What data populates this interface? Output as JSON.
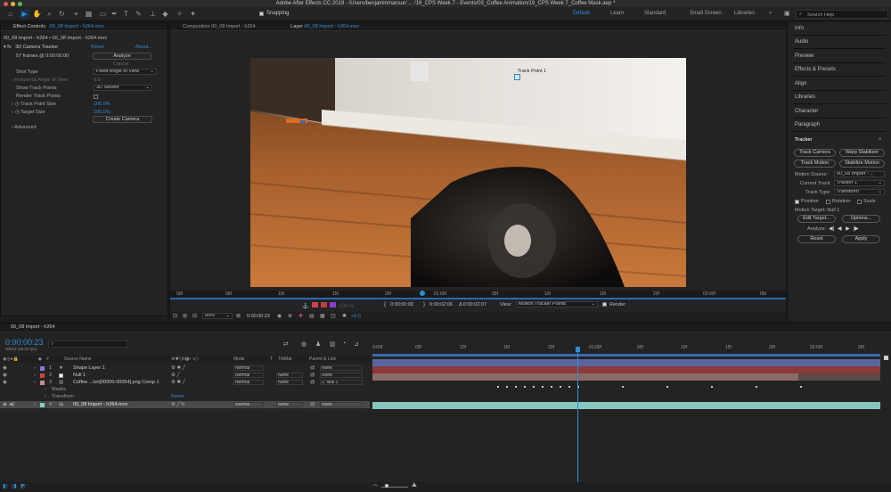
{
  "window": {
    "title": "Adobe After Effects CC 2019 - /Users/benjaminmansur/ ... /19_CPS Week 7 - Events/03_Coffee Animation/19_CPS Week 7_Coffee Mask.aep *"
  },
  "toolbar": {
    "snapping_label": "Snapping",
    "workspaces": [
      "Default",
      "Learn",
      "Standard",
      "Small Screen",
      "Libraries"
    ],
    "active_workspace": "Default",
    "search_placeholder": "Search Help"
  },
  "effect_controls": {
    "tab_label": "Effect Controls",
    "tab_layer": "00_08 Import - h264.mov",
    "breadcrumb": "00_08 Import - h264 • 00_08 Import - h264.mov",
    "effect_name": "3D Camera Tracker",
    "reset_label": "Reset",
    "about_label": "About...",
    "analyze_label": "Analyze",
    "frames_text": "57 frames @ 0:00:00:00",
    "cancel_label": "Cancel",
    "props": {
      "shot_type_label": "Shot Type",
      "shot_type_value": "Fixed Angle of View",
      "hfov_label": "Horizontal Angle of View",
      "hfov_value": "0.0",
      "show_points_label": "Show Track Points",
      "show_points_value": "3D Solved",
      "render_points_label": "Render Track Points",
      "point_size_label": "Track Point Size",
      "point_size_value": "100.0%",
      "target_size_label": "Target Size",
      "target_size_value": "100.0%",
      "create_camera_label": "Create Camera",
      "advanced_label": "Advanced"
    }
  },
  "viewer": {
    "comp_tab": "Composition 00_08 Import - h264",
    "layer_tab_prefix": "Layer",
    "layer_tab_name": "00_08 Import - h264.mov",
    "track_point_label": "Track Point 1",
    "ruler_ticks": [
      "00f",
      "05f",
      "10f",
      "15f",
      "20f",
      "01:00f",
      "05f",
      "10f",
      "15f",
      "20f",
      "02:00f",
      "05f"
    ],
    "in_time": "0:00:00:00",
    "out_time": "0:00:02:06",
    "duration": "Δ 0:00:02:07",
    "view_label": "View:",
    "view_value": "Motion Tracker Points",
    "render_label": "Render",
    "percent_label": "100 %",
    "zoom": "50%",
    "timecode": "0:00:00:23",
    "exposure": "+0.0"
  },
  "right_panel": {
    "items": [
      "Info",
      "Audio",
      "Preview",
      "Effects & Presets",
      "Align",
      "Libraries",
      "Character",
      "Paragraph"
    ],
    "tracker": {
      "title": "Tracker",
      "track_camera": "Track Camera",
      "warp_stabilizer": "Warp Stabilizer",
      "track_motion": "Track Motion",
      "stabilize_motion": "Stabilize Motion",
      "motion_source_label": "Motion Source:",
      "motion_source_value": "00_08 Import - ...",
      "current_track_label": "Current Track:",
      "current_track_value": "Tracker 1",
      "track_type_label": "Track Type:",
      "track_type_value": "Transform",
      "position_label": "Position",
      "rotation_label": "Rotation",
      "scale_label": "Scale",
      "motion_target": "Motion Target: Null 1",
      "edit_target": "Edit Target...",
      "options": "Options...",
      "analyze_label": "Analyze:",
      "reset": "Reset",
      "apply": "Apply"
    }
  },
  "timeline": {
    "tab_label": "00_08 Import - h264",
    "timecode": "0:00:00:23",
    "frame_info": "00023 (25.00 fps)",
    "search_placeholder": "",
    "columns": {
      "source_name": "Source Name",
      "mode": "Mode",
      "t": "T",
      "trkmat": "TrkMat",
      "parent": "Parent & Link"
    },
    "ruler_ticks": [
      "0:00f",
      "05f",
      "10f",
      "15f",
      "20f",
      "01:00f",
      "05f",
      "10f",
      "15f",
      "20f",
      "02:00f",
      "05f"
    ],
    "layers": [
      {
        "num": "1",
        "name": "Shape Layer 1",
        "mode": "Normal",
        "trkmat": "",
        "parent": "None",
        "color": "#7c7ce0",
        "bar": "#5a64a0"
      },
      {
        "num": "2",
        "name": "Null 1",
        "mode": "Normal",
        "trkmat": "None",
        "parent": "None",
        "color": "#d0443c",
        "bar": "#8c3a3a"
      },
      {
        "num": "3",
        "name": "Coffee ...ion[00000-00054].png Comp 1",
        "mode": "Normal",
        "trkmat": "None",
        "parent": "2. Null 1",
        "color": "#c78f86",
        "bar": "#8a6a66"
      }
    ],
    "sub_rows": [
      "Masks",
      "Transform"
    ],
    "transform_reset": "Reset",
    "layer4": {
      "num": "4",
      "name": "00_08 Import - h264.mov",
      "mode": "Normal",
      "trkmat": "None",
      "parent": "None",
      "color": "#7fd0c6",
      "bar": "#86c6be"
    }
  }
}
